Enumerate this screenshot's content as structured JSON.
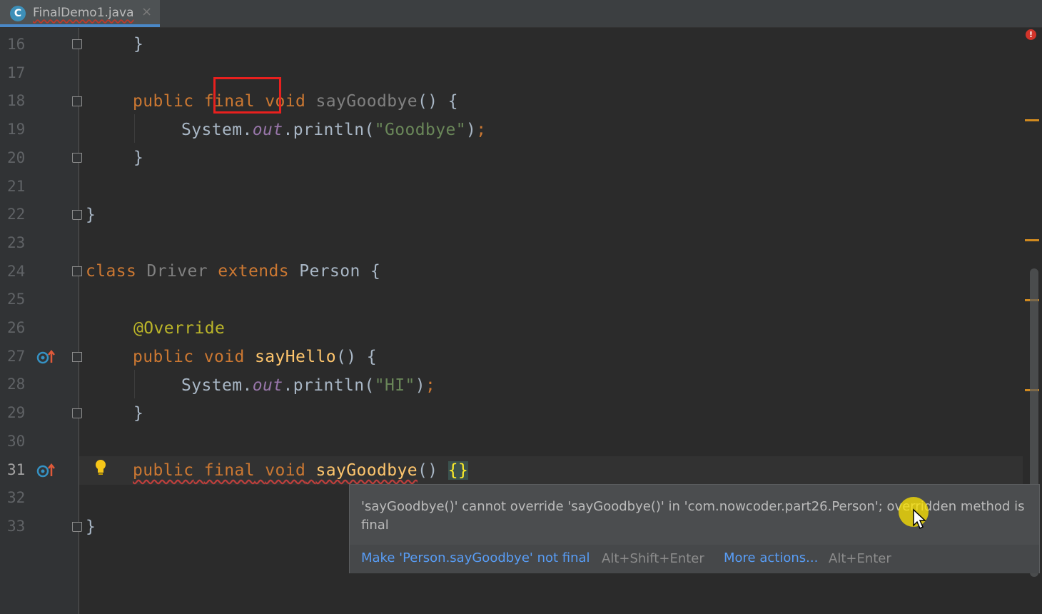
{
  "tab": {
    "icon_letter": "C",
    "filename": "FinalDemo1.java",
    "close": "×"
  },
  "gutter": {
    "line_numbers": [
      "16",
      "17",
      "18",
      "19",
      "20",
      "21",
      "22",
      "23",
      "24",
      "25",
      "26",
      "27",
      "28",
      "29",
      "30",
      "31",
      "32",
      "33"
    ],
    "current_line": "31"
  },
  "code": {
    "l16": "}",
    "l18_public": "public",
    "l18_final": "final",
    "l18_void": "void",
    "l18_name": "sayGoodbye",
    "l18_rest": "() {",
    "l19_system": "System.",
    "l19_out": "out",
    "l19_println": ".println(",
    "l19_str": "\"Goodbye\"",
    "l19_close": ")",
    "l19_semi": ";",
    "l20": "}",
    "l22": "}",
    "l24_class": "class",
    "l24_name": "Driver",
    "l24_extends": "extends",
    "l24_rest": "Person {",
    "l26": "@Override",
    "l27_public": "public",
    "l27_void": "void",
    "l27_name": "sayHello",
    "l27_rest": "() {",
    "l28_system": "System.",
    "l28_out": "out",
    "l28_println": ".println(",
    "l28_str": "\"HI\"",
    "l28_close": ")",
    "l28_semi": ";",
    "l29": "}",
    "l31_public": "public",
    "l31_final": "final",
    "l31_void": "void",
    "l31_name": "sayGoodbye",
    "l31_parens": "()",
    "l31_braces": "{}",
    "l33": "}"
  },
  "error_indicator": "!",
  "tooltip": {
    "message": "'sayGoodbye()' cannot override 'sayGoodbye()' in 'com.nowcoder.part26.Person'; overridden method is final",
    "action1": "Make 'Person.sayGoodbye' not final",
    "action1_shortcut": "Alt+Shift+Enter",
    "action2": "More actions...",
    "action2_shortcut": "Alt+Enter"
  },
  "colors": {
    "background": "#2b2b2b",
    "keyword": "#cc7832",
    "method": "#ffc66d",
    "string": "#6a8759",
    "field": "#9876aa",
    "annotation": "#bbb529",
    "link": "#589df6",
    "highlight_box": "#e8201e"
  }
}
